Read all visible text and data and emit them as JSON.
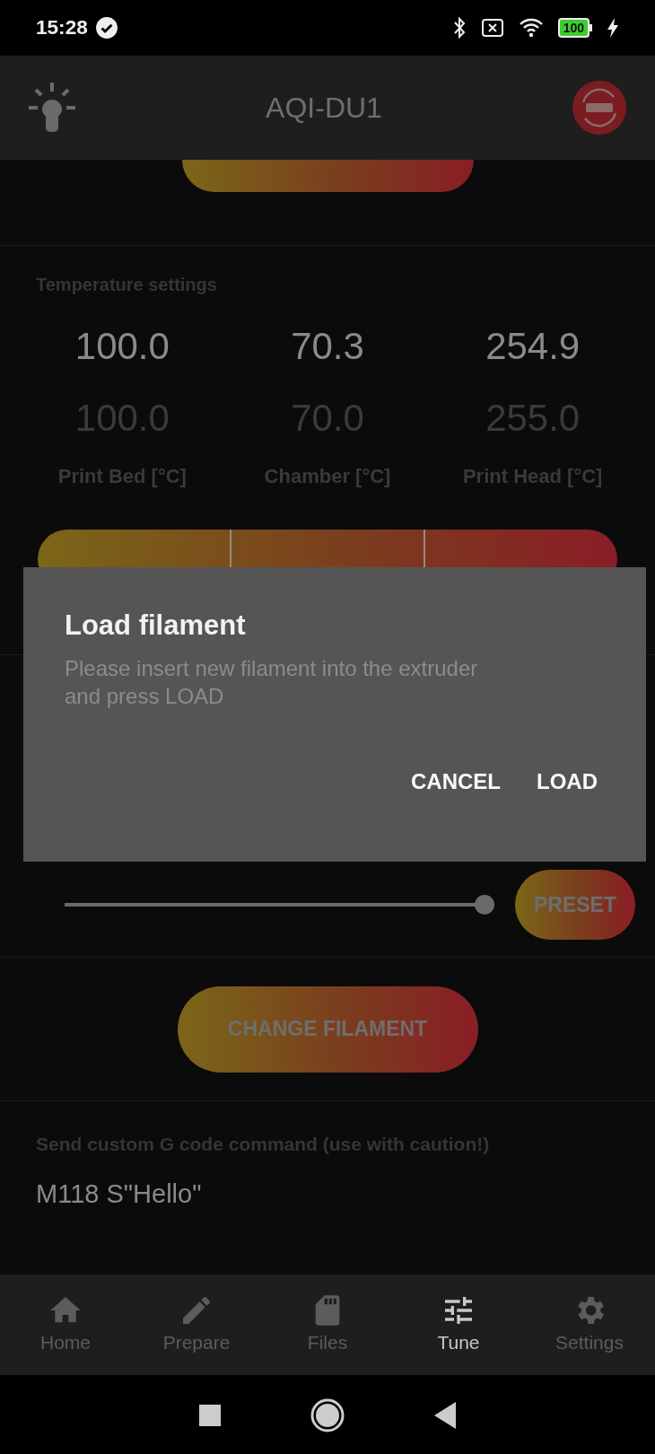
{
  "status_bar": {
    "time": "15:28",
    "battery": "100"
  },
  "app_bar": {
    "title": "AQI-DU1"
  },
  "temperature": {
    "title": "Temperature settings",
    "columns": [
      {
        "current": "100.0",
        "target": "100.0",
        "label": "Print Bed [°C]"
      },
      {
        "current": "70.3",
        "target": "70.0",
        "label": "Chamber [°C]"
      },
      {
        "current": "254.9",
        "target": "255.0",
        "label": "Print Head [°C]"
      }
    ]
  },
  "slider": {
    "level": 1
  },
  "preset_button": "PRESET",
  "change_filament_button": "CHANGE FILAMENT",
  "gcode": {
    "label": "Send custom G code command (use with caution!)",
    "value": "M118 S\"Hello\""
  },
  "dialog": {
    "title": "Load filament",
    "message": "Please insert new filament into the extruder and press LOAD",
    "buttons": [
      "CANCEL",
      "LOAD"
    ]
  },
  "nav": [
    {
      "label": "Home",
      "kind": "home",
      "selected": false
    },
    {
      "label": "Prepare",
      "kind": "prepare",
      "selected": false
    },
    {
      "label": "Files",
      "kind": "files",
      "selected": false
    },
    {
      "label": "Tune",
      "kind": "tune",
      "selected": true
    },
    {
      "label": "Settings",
      "kind": "settings",
      "selected": false
    }
  ]
}
